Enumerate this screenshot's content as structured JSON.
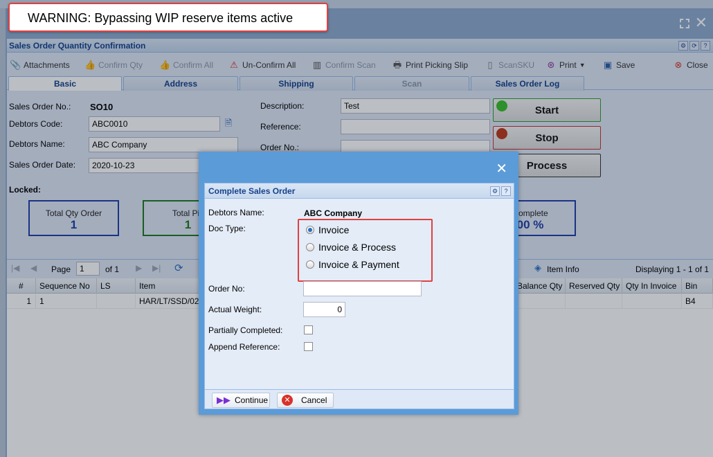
{
  "warning": "WARNING: Bypassing WIP reserve items active",
  "window": {
    "title": "Sales Order Quantity Confirmation"
  },
  "toolbar": {
    "attachments": "Attachments",
    "confirm_qty": "Confirm Qty",
    "confirm_all": "Confirm All",
    "unconfirm_all": "Un-Confirm All",
    "confirm_scan": "Confirm Scan",
    "print_picking_slip": "Print Picking Slip",
    "scan_sku": "ScanSKU",
    "print": "Print",
    "save": "Save",
    "close": "Close"
  },
  "tabs": [
    "Basic",
    "Address",
    "Shipping",
    "Scan",
    "Sales Order Log"
  ],
  "form": {
    "sales_order_no_label": "Sales Order No.:",
    "sales_order_no": "SO10",
    "debtors_code_label": "Debtors Code:",
    "debtors_code": "ABC0010",
    "debtors_name_label": "Debtors Name:",
    "debtors_name": "ABC Company",
    "sales_order_date_label": "Sales Order Date:",
    "sales_order_date": "2020-10-23",
    "locked_label": "Locked:",
    "description_label": "Description:",
    "description": "Test",
    "reference_label": "Reference:",
    "reference": "",
    "order_no_label": "Order No.:",
    "order_no": ""
  },
  "actions": {
    "start": "Start",
    "stop": "Stop",
    "process": "Process"
  },
  "summary": {
    "total_qty_order_label": "Total Qty Order",
    "total_qty_order": "1",
    "total_picked_label": "Total Pic",
    "total_picked": "1",
    "complete_label": "Complete",
    "complete_value": "00 %"
  },
  "pager": {
    "page_label": "Page",
    "page": "1",
    "of": "of 1",
    "item_info": "Item Info",
    "displaying": "Displaying 1 - 1 of 1"
  },
  "grid": {
    "columns": [
      "#",
      "Sequence No",
      "LS",
      "Item",
      "Balance Qty",
      "Reserved Qty",
      "Qty In Invoice",
      "Bin"
    ],
    "rows": [
      {
        "num": "1",
        "seq": "1",
        "ls": "",
        "item": "HAR/LT/SSD/02",
        "balance": "",
        "reserved": "",
        "invoice": "",
        "bin": "B4"
      }
    ]
  },
  "dialog": {
    "title": "Complete Sales Order",
    "debtors_name_label": "Debtors Name:",
    "debtors_name": "ABC Company",
    "doc_type_label": "Doc Type:",
    "doc_types": [
      "Invoice",
      "Invoice & Process",
      "Invoice & Payment"
    ],
    "doc_type_selected": "Invoice",
    "order_no_label": "Order No:",
    "order_no": "",
    "actual_weight_label": "Actual Weight:",
    "actual_weight": "0",
    "partially_completed_label": "Partially Completed:",
    "append_reference_label": "Append Reference:",
    "continue": "Continue",
    "cancel": "Cancel"
  },
  "colors": {
    "highlight": "#e04040",
    "start": "#2e9e2e",
    "stop": "#c83232",
    "primary": "#15428b",
    "dialog_frame": "#5b9bd8"
  }
}
